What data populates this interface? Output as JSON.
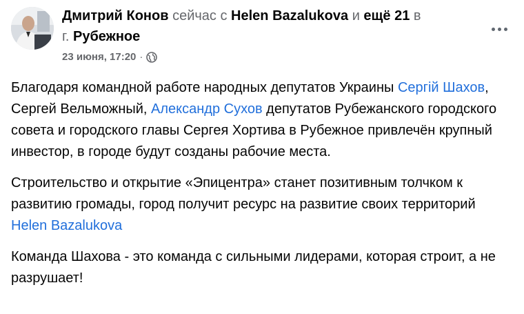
{
  "header": {
    "author": "Дмитрий Конов",
    "time_word": "сейчас",
    "with_word": "с",
    "tagged": "Helen Bazalukova",
    "and_word": "и",
    "others": "ещё 21",
    "in_word": "в",
    "place_prefix": "г.",
    "place": "Рубежное",
    "date": "23 июня, 17:20",
    "separator": "·"
  },
  "post": {
    "p1": {
      "t1": "Благодаря командной работе народных депутатов Украины ",
      "m1": "Сергій Шахов",
      "t2": ", Сергей Вельможный, ",
      "m2": "Александр Сухов",
      "t3": " депутатов Рубежанского городского совета  и городского главы Сергея Хортива в Рубежное привлечён крупный инвестор, в городе будут созданы рабочие места."
    },
    "p2": {
      "t1": "Строительство и открытие «Эпицентра» станет позитивным толчком к развитию громады, город получит ресурс на развитие своих территорий ",
      "m1": "Helen Bazalukova"
    },
    "p3": {
      "t1": "Команда Шахова - это команда с сильными лидерами, которая строит, а не разрушает!"
    }
  },
  "colors": {
    "link": "#216fdb",
    "muted": "#65676b",
    "text": "#050505"
  },
  "icons": {
    "privacy": "globe-icon",
    "menu": "more-dots-icon"
  }
}
